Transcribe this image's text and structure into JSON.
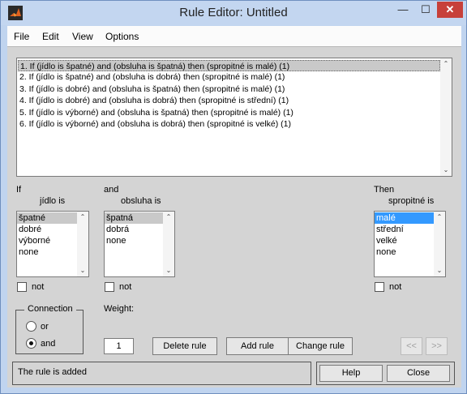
{
  "window": {
    "title": "Rule Editor: Untitled",
    "minimize": "—",
    "maximize": "☐",
    "close": "✕"
  },
  "menu": [
    "File",
    "Edit",
    "View",
    "Options"
  ],
  "rules": [
    "1. If (jídlo is špatné) and (obsluha is špatná) then (spropitné is malé) (1)",
    "2. If (jídlo is špatné) and (obsluha is dobrá) then (spropitné is malé) (1)",
    "3. If (jídlo is dobré) and (obsluha is špatná) then (spropitné is malé) (1)",
    "4. If (jídlo is dobré) and (obsluha is dobrá) then (spropitné is střední) (1)",
    "5. If (jídlo is výborné) and (obsluha is špatná) then (spropitné is malé) (1)",
    "6. If (jídlo is výborné) and (obsluha is dobrá) then (spropitné is velké) (1)"
  ],
  "selected_rule": 0,
  "input1": {
    "header": "If",
    "variable": "jídlo is",
    "items": [
      "špatné",
      "dobré",
      "výborné",
      "none"
    ],
    "selected": 0,
    "not_label": "not"
  },
  "input2": {
    "header": "and",
    "variable": "obsluha is",
    "items": [
      "špatná",
      "dobrá",
      "none"
    ],
    "selected": 0,
    "not_label": "not"
  },
  "output": {
    "header": "Then",
    "variable": "spropitné is",
    "items": [
      "malé",
      "střední",
      "velké",
      "none"
    ],
    "selected": 0,
    "not_label": "not"
  },
  "connection": {
    "title": "Connection",
    "options": [
      "or",
      "and"
    ],
    "selected": "and"
  },
  "weight": {
    "label": "Weight:",
    "value": "1"
  },
  "buttons": {
    "delete": "Delete rule",
    "add": "Add rule",
    "change": "Change rule",
    "prev": "<<",
    "next": ">>",
    "help": "Help",
    "close": "Close"
  },
  "status": "The rule is added"
}
